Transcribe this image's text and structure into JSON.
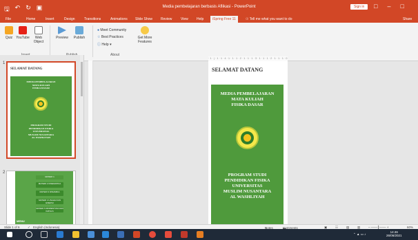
{
  "window": {
    "title": "Media pembelajaran berbasis Aflikasi  -  PowerPoint",
    "sign_in": "Sign in"
  },
  "quick_access": [
    "save-icon",
    "undo-icon",
    "redo-icon",
    "present-icon"
  ],
  "tabs": [
    "File",
    "Home",
    "Insert",
    "Design",
    "Transitions",
    "Animations",
    "Slide Show",
    "Review",
    "View",
    "Help",
    "iSpring Free 11",
    "Tell me what you want to do",
    "Share"
  ],
  "active_tab": "iSpring Free 11",
  "ribbon": {
    "quiz": "Quiz",
    "youtube": "YouTube",
    "web_object": "Web Object",
    "preview": "Preview",
    "publish": "Publish",
    "meet_community": "Meet Community",
    "best_practices": "Best Practices",
    "help": "Help",
    "get_more_features": "Get More Features",
    "group_insert": "Insert",
    "group_publish": "Publish",
    "group_about": "About"
  },
  "thumbnails": {
    "slide1_number": "1",
    "slide2_number": "2",
    "slide2_buttons": [
      "MATERI 1",
      "MATERI 2 KINEMATIKA",
      "MATERI 3 DINAMIKA",
      "MATERI 4 USAHA DAN ENERGI",
      "MATERI 5 MOMENTUM DAN IMPULS"
    ],
    "slide2_menu": "MENU"
  },
  "slide": {
    "heading": "SELAMAT DATANG",
    "top_text": [
      "MEDIA PEMBELAJARAN",
      "MATA KULIAH",
      "FISIKA DASAR"
    ],
    "bottom_text": [
      "PROGRAM STUDI",
      "PENDIDIKAN FISIKA",
      "UNIVERSITAS",
      "MUSLIM NUSANTARA",
      "AL WASHLIYAH"
    ]
  },
  "ruler": "·1·|·1·1·4·1·1·1·2·1·1·1·3·1·1·1·2·1·1·1·0·",
  "status": {
    "slide_of": "Slide 1 of 6",
    "language": "English (Indonesia)",
    "notes": "Notes",
    "comments": "Comments",
    "zoom": "60%"
  },
  "taskbar": {
    "time": "14:46",
    "date": "26/06/2021"
  },
  "colors": {
    "accent": "#d24726",
    "slide_green": "#4f9a3c"
  }
}
